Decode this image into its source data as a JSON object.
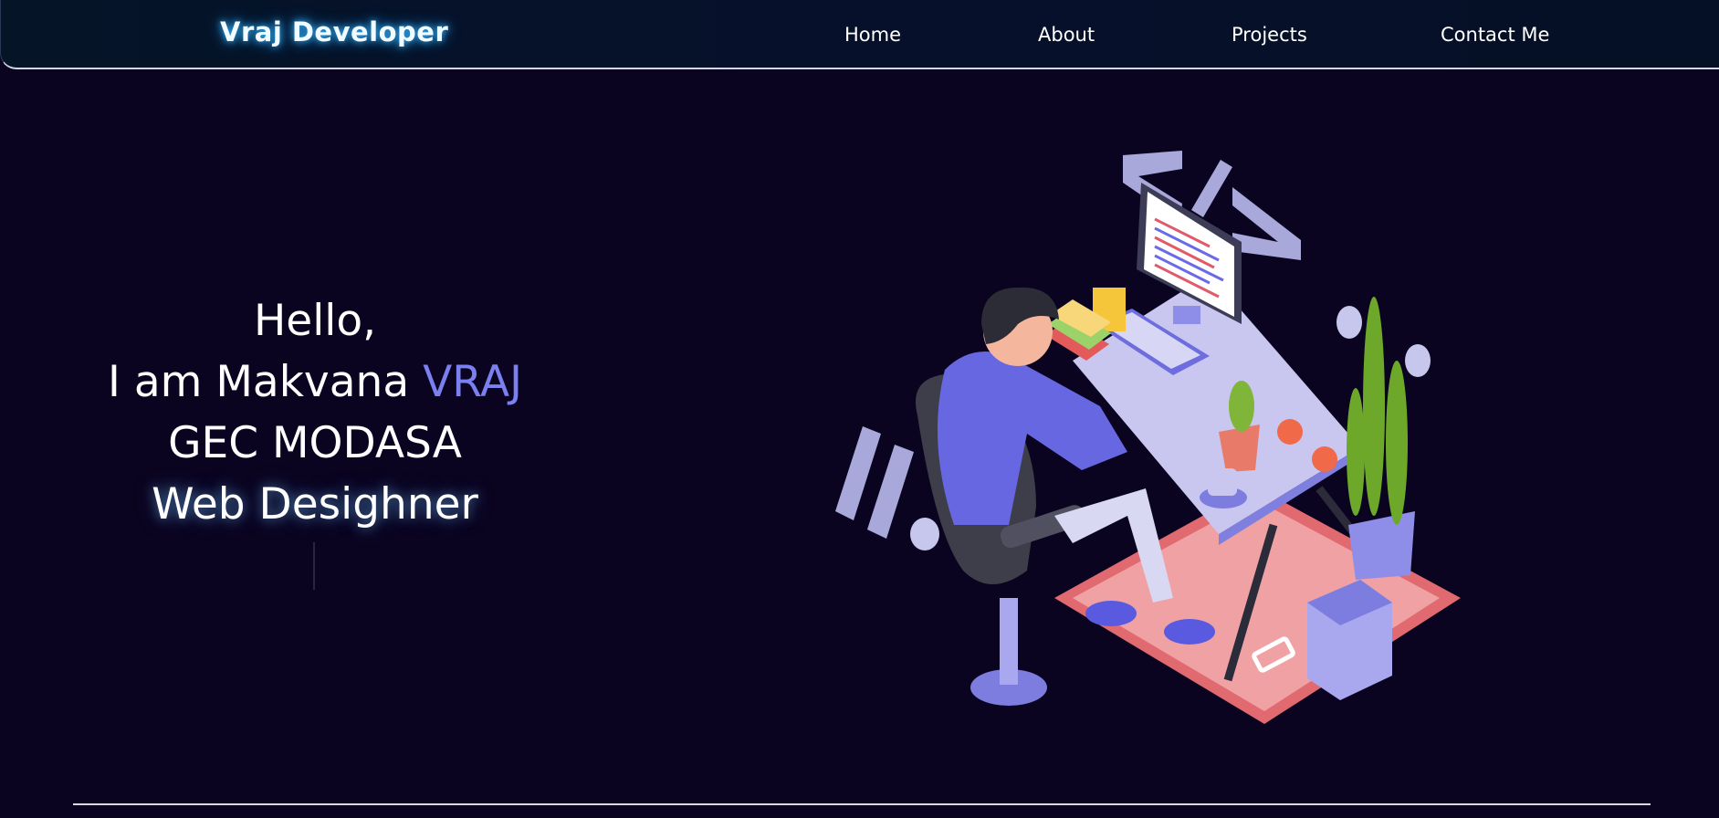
{
  "navbar": {
    "brand": "Vraj Developer",
    "links": [
      {
        "label": "Home"
      },
      {
        "label": "About"
      },
      {
        "label": "Projects"
      },
      {
        "label": "Contact Me"
      }
    ]
  },
  "hero": {
    "greeting": "Hello,",
    "intro_prefix": "I am Makvana ",
    "name_highlight": "VRAJ",
    "college": "GEC MODASA",
    "role": "Web Desighner"
  },
  "colors": {
    "background": "#0b0420",
    "accent": "#7b7ff0",
    "brand_glow": "#35b7ff"
  },
  "illustration": {
    "icon": "developer-at-desk-illustration"
  }
}
